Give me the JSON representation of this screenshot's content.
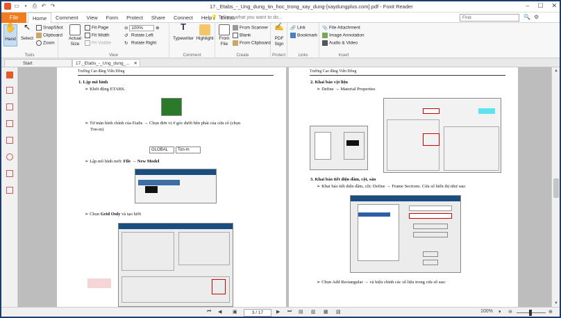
{
  "window": {
    "title": "17._Etabs_-_Ung_dung_tin_hoc_trong_xay_dung-[xaydungplus.com].pdf - Foxit Reader"
  },
  "menu": {
    "file": "File",
    "tabs": [
      "Home",
      "Comment",
      "View",
      "Form",
      "Protect",
      "Share",
      "Connect",
      "Help",
      "Extras"
    ],
    "tell_me": "Tell me what you want to do...",
    "find_placeholder": "Find"
  },
  "ribbon": {
    "tools": {
      "label": "Tools",
      "hand": "Hand",
      "select": "Select",
      "snapshot": "SnapShot",
      "clipboard": "Clipboard",
      "zoom": "Zoom"
    },
    "view": {
      "label": "View",
      "actual_size": "Actual\nSize",
      "fit_page": "Fit Page",
      "fit_width": "Fit Width",
      "fit_visible": "Fit Visible",
      "zoom_value": "100%",
      "rotate_left": "Rotate Left",
      "rotate_right": "Rotate Right"
    },
    "comment": {
      "label": "Comment",
      "typewriter": "Typewriter",
      "highlight": "Highlight"
    },
    "create": {
      "label": "Create",
      "from_file": "From\nFile",
      "from_scanner": "From Scanner",
      "blank": "Blank",
      "from_clipboard": "From Clipboard"
    },
    "protect": {
      "label": "Protect",
      "pdf_sign": "PDF\nSign"
    },
    "links": {
      "label": "Links",
      "link": "Link",
      "bookmark": "Bookmark"
    },
    "insert": {
      "label": "Insert",
      "file_attachment": "File Attachment",
      "image_annotation": "Image Annotation",
      "audio_video": "Audio & Video"
    }
  },
  "doc_tabs": [
    {
      "label": "Start"
    },
    {
      "label": "17._Etabs_-_Ung_dung_..."
    }
  ],
  "page_left": {
    "header": "Trường Cao đẳng Viễn Đông",
    "h1": "1.  Lập mô hình",
    "b1": "Khởi động ETABS.",
    "b2a": "Từ màn hình chính của Etabs → Chọn đơn vị ở góc dưới bên phải của cửa sổ (chọn",
    "b2b": "Ton-m)",
    "unit1": "GLOBAL",
    "unit2": "Ton-m",
    "b3_pre": "Lập mô hình mới: ",
    "b3_bold": "File → New Model",
    "b4_pre": "Chọn ",
    "b4_bold": "Grid Only",
    "b4_post": " và tạo lưới"
  },
  "page_right": {
    "header": "Trường Cao đẳng Viễn Đông",
    "h2": "2.  Khai báo vật liệu",
    "b1": "Define → Material Properties",
    "h3": "3.  Khai báo tiết diện dầm, cột, sàn",
    "b2": "Khai báo tiết diện dầm, cột: Define → Frame Sections. Cửa sổ hiển thị như sau:",
    "b3": "Chọn Add Rectangular → và hiệu chỉnh các số liệu trong cửa sổ sau:"
  },
  "status": {
    "page": "3 / 17",
    "zoom": "100%"
  }
}
